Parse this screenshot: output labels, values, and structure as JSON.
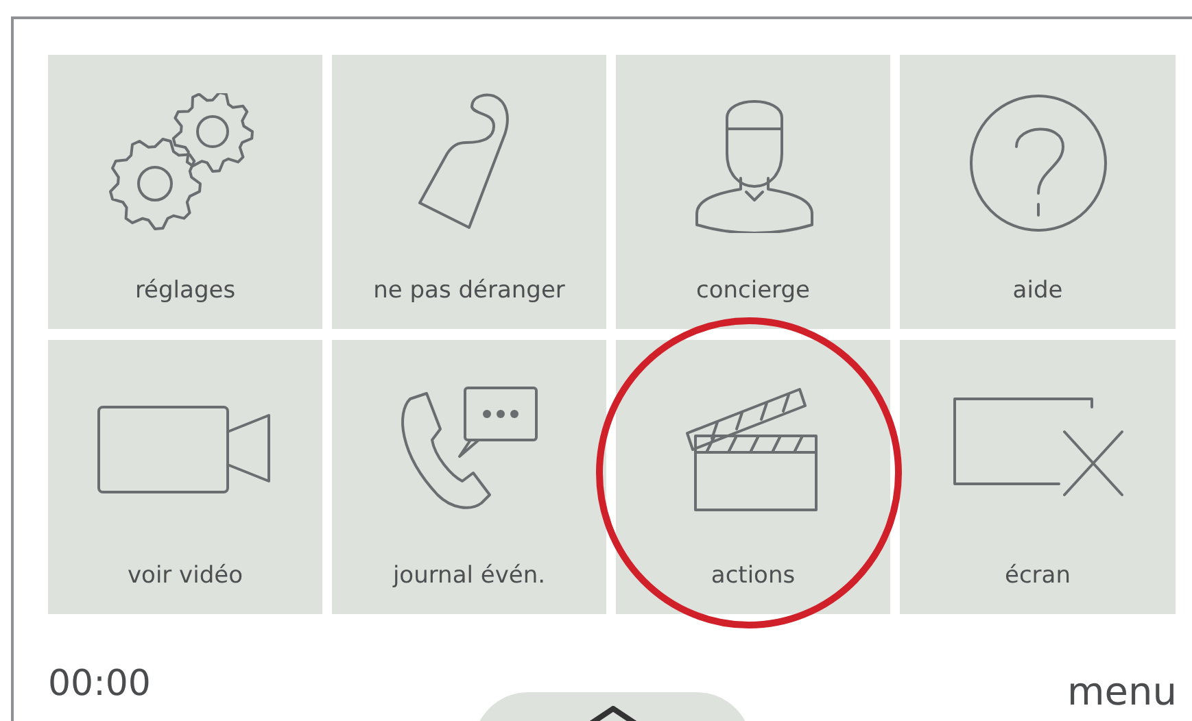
{
  "tiles": [
    {
      "kind": "gears",
      "label": "réglages",
      "circled": false
    },
    {
      "kind": "door-hanger",
      "label": "ne pas déranger",
      "circled": false
    },
    {
      "kind": "concierge",
      "label": "concierge",
      "circled": false
    },
    {
      "kind": "help",
      "label": "aide",
      "circled": false
    },
    {
      "kind": "camera",
      "label": "voir vidéo",
      "circled": false
    },
    {
      "kind": "call-log",
      "label": "journal évén.",
      "circled": false
    },
    {
      "kind": "clapper",
      "label": "actions",
      "circled": true
    },
    {
      "kind": "screen-off",
      "label": "écran",
      "circled": false
    }
  ],
  "status": {
    "time": "00:00",
    "menu": "menu"
  }
}
